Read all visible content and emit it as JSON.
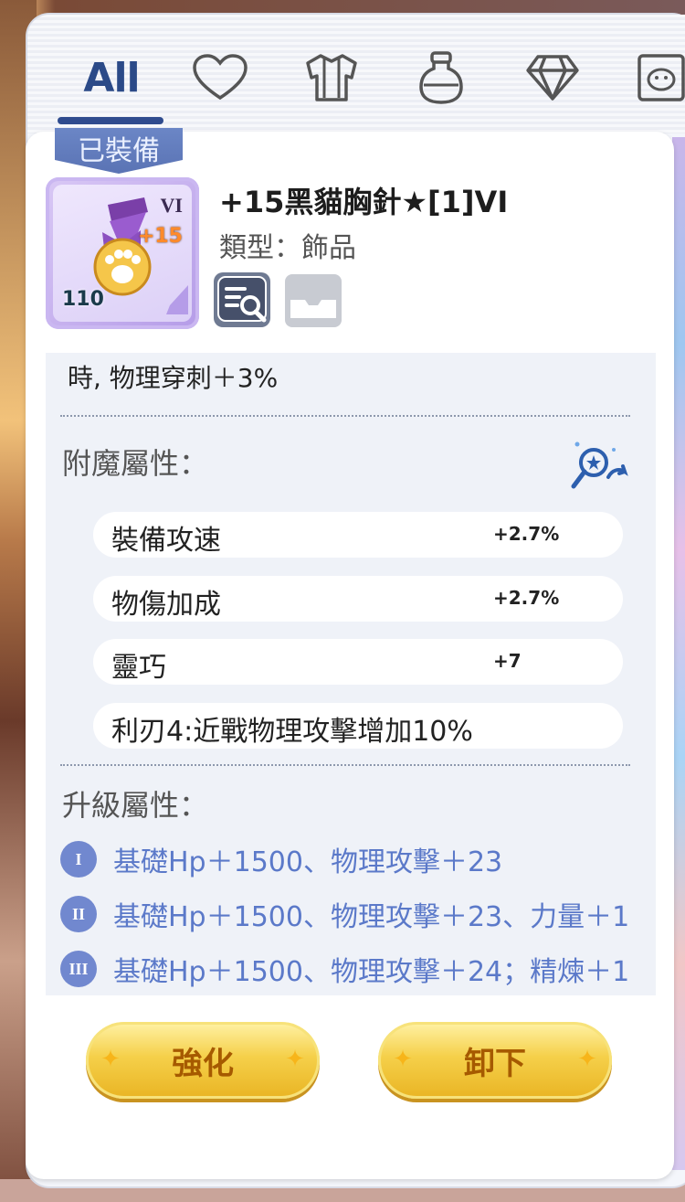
{
  "tabs": {
    "all_label": "All",
    "icons": [
      "heart-icon",
      "armor-icon",
      "potion-icon",
      "diamond-icon",
      "pet-icon"
    ]
  },
  "item": {
    "equipped_badge": "已裝備",
    "rank": "VI",
    "enhance_level": "+15",
    "level": "110",
    "name": "+15黑貓胸針★[1]VI",
    "type": "類型：飾品"
  },
  "details": {
    "effect_line": "時, 物理穿刺＋3%",
    "enchant_title": "附魔屬性：",
    "enchant_stats": [
      {
        "label": "裝備攻速",
        "value": "+2.7%"
      },
      {
        "label": "物傷加成",
        "value": "+2.7%"
      },
      {
        "label": "靈巧",
        "value": "+7"
      },
      {
        "label": "利刃4:近戰物理攻擊增加10%",
        "value": ""
      }
    ],
    "upgrade_title": "升級屬性：",
    "upgrade_stats": [
      {
        "tier": "I",
        "text": "基礎Hp＋1500、物理攻擊＋23"
      },
      {
        "tier": "II",
        "text": "基礎Hp＋1500、物理攻擊＋23、力量＋1"
      },
      {
        "tier": "III",
        "text": "基礎Hp＋1500、物理攻擊＋24；精煉＋1"
      }
    ]
  },
  "actions": {
    "enhance_label": "強化",
    "unequip_label": "卸下"
  },
  "colors": {
    "tab_active": "#2b4a88",
    "upgrade_text": "#5b79c9",
    "button_gold": "#f5d04a",
    "button_text": "#a65a00"
  }
}
